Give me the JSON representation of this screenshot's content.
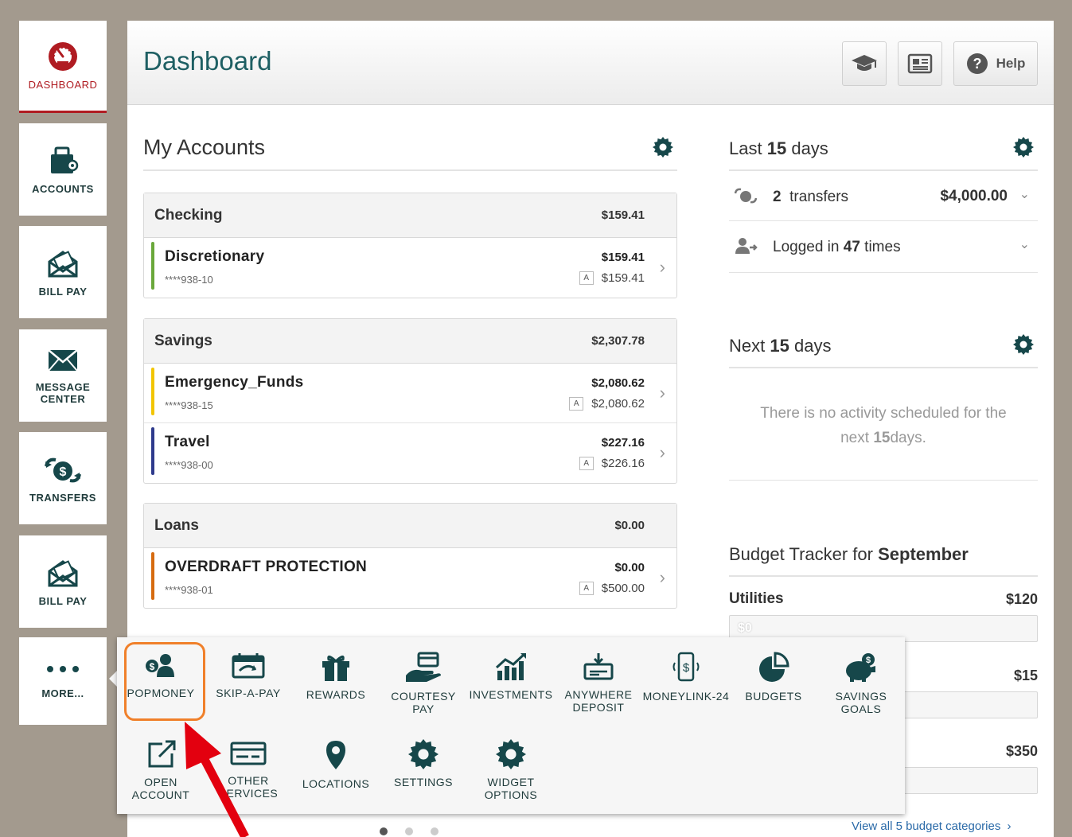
{
  "sidebar": {
    "items": [
      {
        "label": "DASHBOARD",
        "icon": "speedometer-icon"
      },
      {
        "label": "ACCOUNTS",
        "icon": "wallet-icon"
      },
      {
        "label": "BILL PAY",
        "icon": "envelope-bill-icon"
      },
      {
        "label": "MESSAGE CENTER",
        "icon": "mail-icon"
      },
      {
        "label": "TRANSFERS",
        "icon": "transfer-icon"
      },
      {
        "label": "BILL PAY",
        "icon": "envelope-bill-icon"
      },
      {
        "label": "MORE...",
        "icon": "more-dots-icon"
      }
    ]
  },
  "header": {
    "title": "Dashboard",
    "help_label": "Help"
  },
  "accounts": {
    "title": "My Accounts",
    "groups": [
      {
        "name": "Checking",
        "total": "$159.41",
        "accounts": [
          {
            "name": "Discretionary",
            "number": "****938-10",
            "balance": "$159.41",
            "available_tag": "A",
            "available": "$159.41",
            "color": "#6aa83b"
          }
        ]
      },
      {
        "name": "Savings",
        "total": "$2,307.78",
        "accounts": [
          {
            "name": "Emergency_Funds",
            "number": "****938-15",
            "balance": "$2,080.62",
            "available_tag": "A",
            "available": "$2,080.62",
            "color": "#f2c500"
          },
          {
            "name": "Travel",
            "number": "****938-00",
            "balance": "$227.16",
            "available_tag": "A",
            "available": "$226.16",
            "color": "#2e3a8c"
          }
        ]
      },
      {
        "name": "Loans",
        "total": "$0.00",
        "accounts": [
          {
            "name": "OVERDRAFT PROTECTION",
            "number": "****938-01",
            "balance": "$0.00",
            "available_tag": "A",
            "available": "$500.00",
            "color": "#d66b10"
          }
        ]
      }
    ]
  },
  "last15": {
    "title_pre": "Last",
    "title_num": "15",
    "title_post": "days",
    "transfers_count": "2",
    "transfers_label": "transfers",
    "transfers_amount": "$4,000.00",
    "login_pre": "Logged in",
    "login_count": "47",
    "login_post": "times"
  },
  "next15": {
    "title_pre": "Next",
    "title_num": "15",
    "title_post": "days",
    "empty_line1": "There is no activity scheduled for the",
    "empty_pre": "next",
    "empty_num": "15",
    "empty_post": "days."
  },
  "budget": {
    "title_pre": "Budget Tracker for",
    "month": "September",
    "categories": [
      {
        "name": "Utilities",
        "amount": "$120",
        "spent": "$0"
      },
      {
        "name": "",
        "amount": "$15",
        "spent": ""
      },
      {
        "name": "",
        "amount": "$350",
        "spent": ""
      }
    ],
    "view_all": "View all 5 budget categories"
  },
  "more_menu": {
    "items": [
      {
        "label": "POPMONEY",
        "icon": "popmoney-icon"
      },
      {
        "label": "SKIP-A-PAY",
        "icon": "calendar-skip-icon"
      },
      {
        "label": "REWARDS",
        "icon": "gift-icon"
      },
      {
        "label": "COURTESY PAY",
        "icon": "card-hand-icon"
      },
      {
        "label": "INVESTMENTS",
        "icon": "chart-growth-icon"
      },
      {
        "label": "ANYWHERE DEPOSIT",
        "icon": "deposit-icon"
      },
      {
        "label": "MONEYLINK-24",
        "icon": "phone-dollar-icon"
      },
      {
        "label": "BUDGETS",
        "icon": "pie-chart-icon"
      },
      {
        "label": "SAVINGS GOALS",
        "icon": "piggy-bank-icon"
      },
      {
        "label": "OPEN ACCOUNT",
        "icon": "external-link-icon"
      },
      {
        "label": "OTHER SERVICES",
        "icon": "card-icon"
      },
      {
        "label": "LOCATIONS",
        "icon": "map-pin-icon"
      },
      {
        "label": "SETTINGS",
        "icon": "gear-icon"
      },
      {
        "label": "WIDGET OPTIONS",
        "icon": "gear-icon"
      }
    ]
  },
  "colors": {
    "brand_teal": "#1e5f63",
    "icon_dark_teal": "#16474a",
    "active_red": "#b01c22",
    "highlight_orange": "#f0802a",
    "annotation_arrow": "#e3000f"
  }
}
